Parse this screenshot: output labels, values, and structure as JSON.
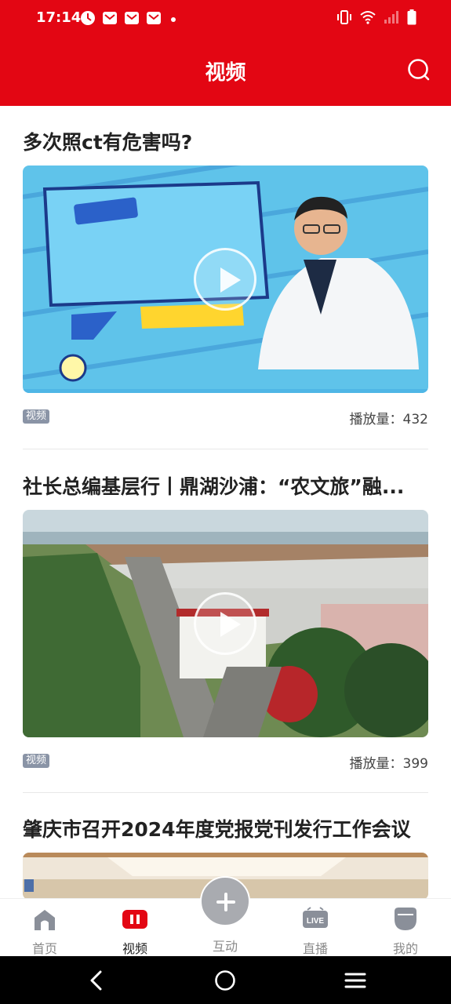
{
  "status_bar": {
    "time": "17:14",
    "icons": [
      "dnd-icon",
      "mail-icon",
      "mail-icon",
      "mail-icon",
      "dot-icon",
      "vibrate-icon",
      "wifi-icon",
      "signal-icon",
      "battery-icon"
    ]
  },
  "header": {
    "title": "视频",
    "search_icon": "search-icon",
    "color": "#e30613"
  },
  "feed": {
    "articles": [
      {
        "title": "多次照ct有危害吗?",
        "tag": "视频",
        "plays": "播放量：432"
      },
      {
        "title": "社长总编基层行丨鼎湖沙浦：“农文旅”融...",
        "tag": "视频",
        "plays": "播放量：399"
      },
      {
        "title": "肇庆市召开2024年度党报党刊发行工作会议"
      }
    ]
  },
  "tabbar": {
    "tabs": [
      {
        "label": "首页",
        "icon": "home-icon"
      },
      {
        "label": "视频",
        "icon": "video-icon",
        "active": true
      },
      {
        "label": "互动",
        "icon": "plus-icon"
      },
      {
        "label": "直播",
        "icon": "live-icon"
      },
      {
        "label": "我的",
        "icon": "profile-icon"
      }
    ]
  },
  "navbar": {
    "icons": [
      "back-icon",
      "home-circle-icon",
      "menu-icon"
    ]
  }
}
